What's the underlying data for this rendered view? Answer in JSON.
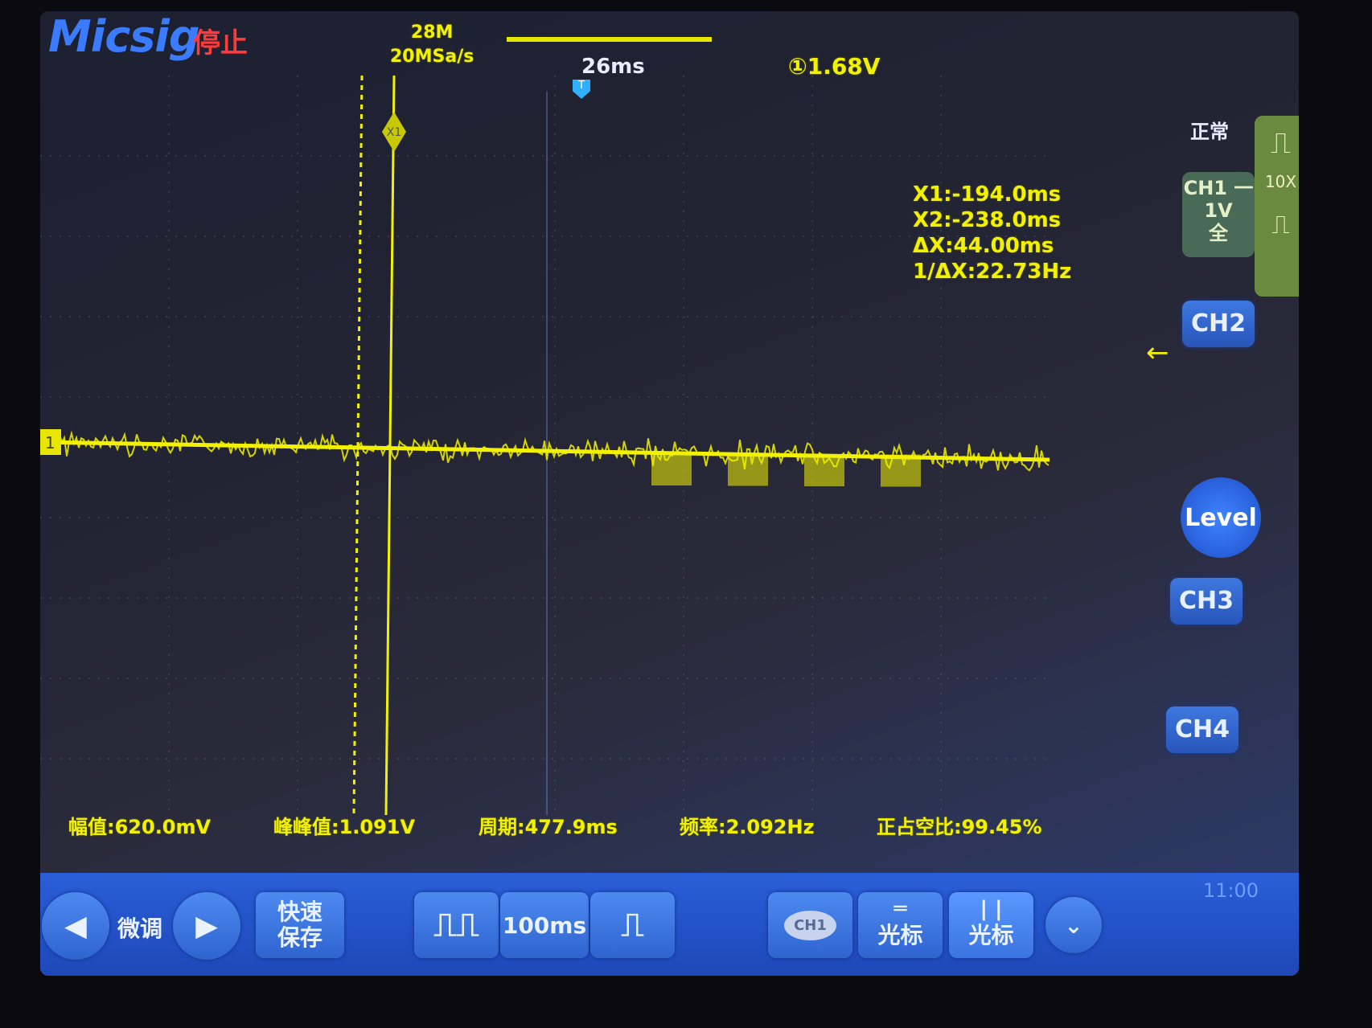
{
  "header": {
    "brand": "Micsig",
    "run_status": "停止",
    "memory_depth": "28M",
    "sample_rate": "20MSa/s",
    "timebase_position": "26ms",
    "trigger_level": "①1.68V"
  },
  "cursors": {
    "x1_label": "X1",
    "x1": "X1:-194.0ms",
    "x2": "X2:-238.0ms",
    "delta_x": "ΔX:44.00ms",
    "inv_delta_x": "1/ΔX:22.73Hz"
  },
  "channel_marker": "1",
  "trigger_marker": "T",
  "side_panel": {
    "acq_mode": "正常",
    "ch1_name": "CH1",
    "ch1_coupling": "一",
    "ch1_scale": "1V",
    "ch1_bandwidth": "全",
    "probe_ratio": "10X",
    "ch2": "CH2",
    "level": "Level",
    "ch3": "CH3",
    "ch4": "CH4"
  },
  "measurements": [
    {
      "label": "幅值:620.0mV"
    },
    {
      "label": "峰峰值:1.091V"
    },
    {
      "label": "周期:477.9ms"
    },
    {
      "label": "频率:2.092Hz"
    },
    {
      "label": "正占空比:99.45%"
    }
  ],
  "toolbar": {
    "fine_adjust": "微调",
    "quick_save_line1": "快速",
    "quick_save_line2": "保存",
    "time_scale": "100ms",
    "ch1_select": "CH1",
    "cursor_h": "光标",
    "cursor_v": "光标"
  },
  "clock": "11:00",
  "colors": {
    "trace": "#f2f200",
    "accent_blue": "#2a5ed8",
    "stop_red": "#ff3a3a"
  }
}
